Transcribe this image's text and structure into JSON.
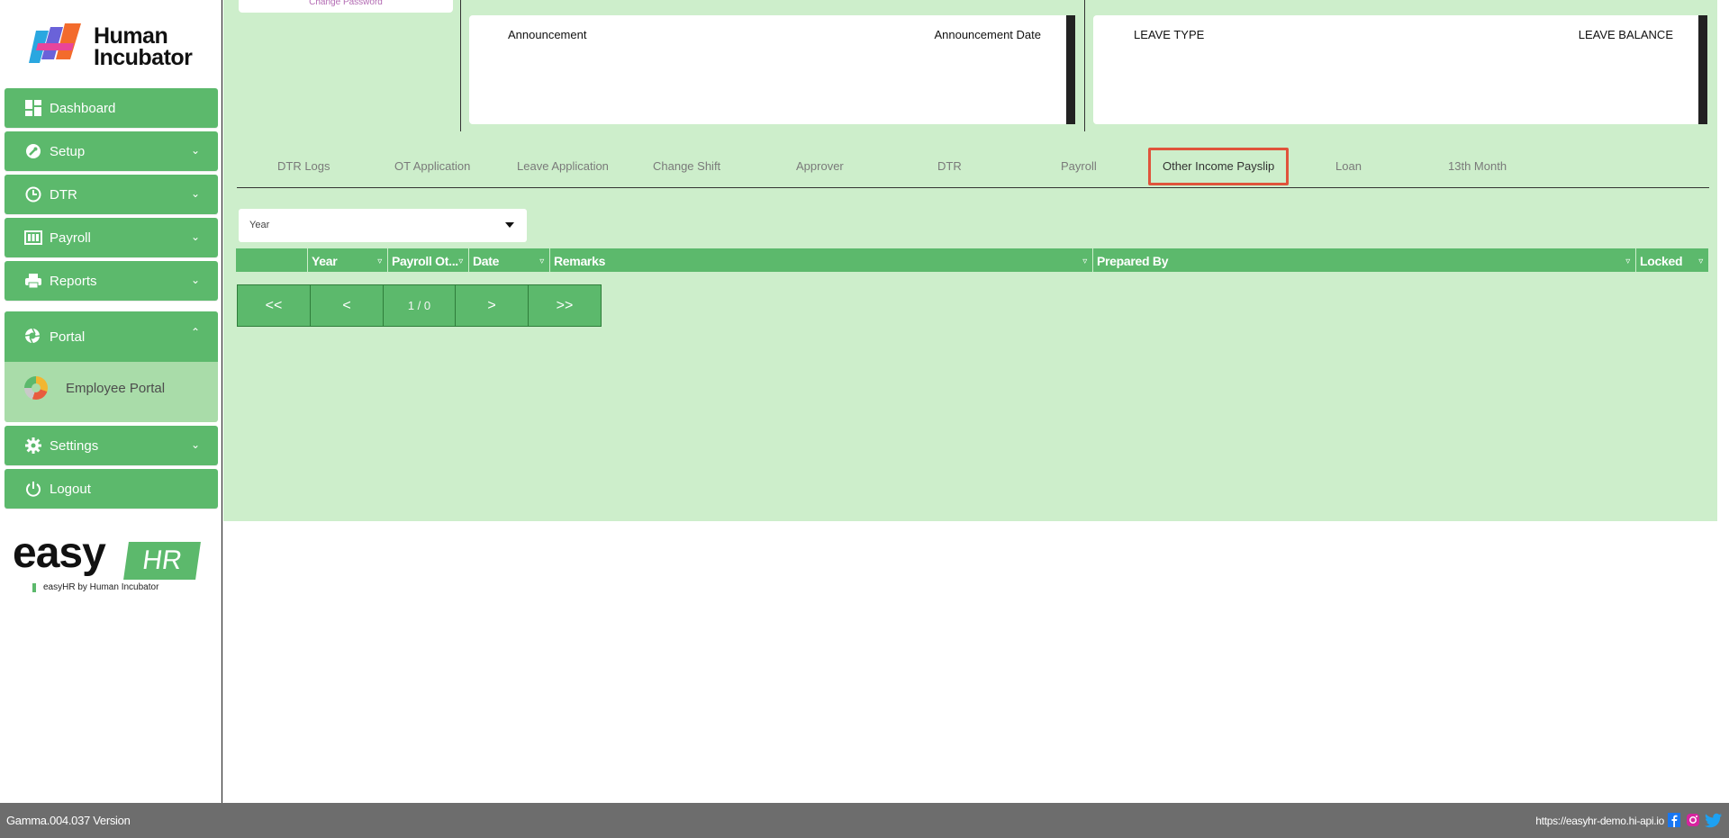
{
  "brand": {
    "name": "Human Incubator"
  },
  "sidebar": {
    "items": [
      {
        "label": "Dashboard",
        "icon": "dashboard-icon"
      },
      {
        "label": "Setup",
        "icon": "wrench-icon"
      },
      {
        "label": "DTR",
        "icon": "clock-icon"
      },
      {
        "label": "Payroll",
        "icon": "payroll-icon"
      },
      {
        "label": "Reports",
        "icon": "printer-icon"
      },
      {
        "label": "Portal",
        "icon": "aperture-icon"
      },
      {
        "label": "Settings",
        "icon": "gear-icon"
      },
      {
        "label": "Logout",
        "icon": "power-icon"
      }
    ],
    "portal_sub": {
      "label": "Employee Portal",
      "icon": "employee-portal-icon"
    }
  },
  "easyhr": {
    "word": "easy",
    "hr": "HR",
    "tagline": "easyHR by Human Incubator"
  },
  "top_card": {
    "label": "Change Password"
  },
  "announcements": {
    "col1": "Announcement",
    "col2": "Announcement Date"
  },
  "leave": {
    "col1": "LEAVE TYPE",
    "col2": "LEAVE BALANCE"
  },
  "tabs": [
    {
      "label": "DTR Logs"
    },
    {
      "label": "OT Application"
    },
    {
      "label": "Leave Application"
    },
    {
      "label": "Change Shift"
    },
    {
      "label": "Approver"
    },
    {
      "label": "DTR"
    },
    {
      "label": "Payroll"
    },
    {
      "label": "Other Income Payslip",
      "active": true
    },
    {
      "label": "Loan"
    },
    {
      "label": "13th Month"
    }
  ],
  "year_select": {
    "value": "Year"
  },
  "grid": {
    "columns": [
      "",
      "Year",
      "Payroll Ot...",
      "Date",
      "Remarks",
      "Prepared By",
      "Locked"
    ]
  },
  "pager": {
    "first": "<<",
    "prev": "<",
    "info": "1 / 0",
    "next": ">",
    "last": ">>"
  },
  "footer": {
    "version": "Gamma.004.037 Version",
    "url": "https://easyhr-demo.hi-api.io"
  },
  "colors": {
    "accent": "#5cb96c",
    "bg": "#cdeecb",
    "highlight": "#e0533b",
    "footer": "#6d6d6d"
  }
}
